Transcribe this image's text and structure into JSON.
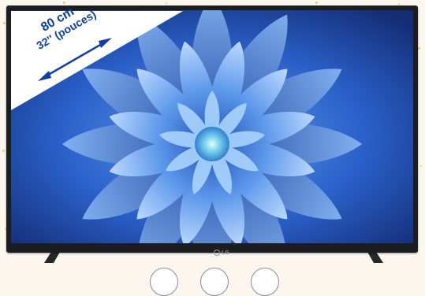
{
  "size_badge": {
    "cm": "80 cm",
    "inches": "32'' (pouces)"
  },
  "brand": "LG",
  "colors": {
    "frame": "#1c1d21",
    "screen_blue": "#2f6fd6",
    "badge_text": "#0f3fa6",
    "background": "#fbf7ee"
  },
  "icons": [
    "double-arrow-icon",
    "flower-image"
  ]
}
